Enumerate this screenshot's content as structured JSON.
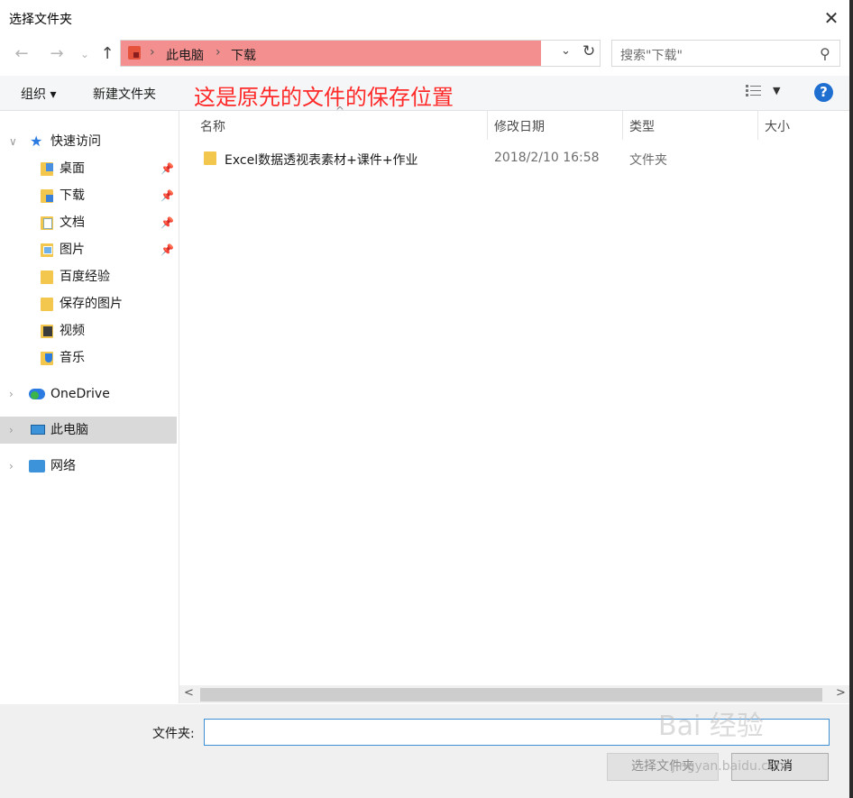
{
  "window": {
    "title": "选择文件夹"
  },
  "address": {
    "crumbs": [
      "此电脑",
      "下载"
    ],
    "sep": "›"
  },
  "search": {
    "placeholder": "搜索\"下载\""
  },
  "toolbar": {
    "organize": "组织 ▾",
    "new_folder": "新建文件夹",
    "annotation": "这是原先的文件的保存位置"
  },
  "sidebar": {
    "quick_access": "快速访问",
    "items": [
      {
        "label": "桌面",
        "pinned": true
      },
      {
        "label": "下载",
        "pinned": true
      },
      {
        "label": "文档",
        "pinned": true
      },
      {
        "label": "图片",
        "pinned": true
      },
      {
        "label": "百度经验",
        "pinned": false
      },
      {
        "label": "保存的图片",
        "pinned": false
      },
      {
        "label": "视频",
        "pinned": false
      },
      {
        "label": "音乐",
        "pinned": false
      }
    ],
    "onedrive": "OneDrive",
    "this_pc": "此电脑",
    "network": "网络"
  },
  "columns": {
    "name": "名称",
    "modified": "修改日期",
    "type": "类型",
    "size": "大小"
  },
  "files": [
    {
      "name": "Excel数据透视表素材+课件+作业",
      "modified": "2018/2/10 16:58",
      "type": "文件夹",
      "size": ""
    }
  ],
  "footer": {
    "folder_label": "文件夹:",
    "folder_value": "",
    "select_button": "选择文件夹",
    "cancel_button": "取消"
  },
  "watermark": {
    "logo": "Bai 经验",
    "url": "jingyan.baidu.com"
  },
  "colors": {
    "highlight": "#f48f8f",
    "annotation": "#ff2a2a",
    "accent": "#1f6fd1"
  }
}
